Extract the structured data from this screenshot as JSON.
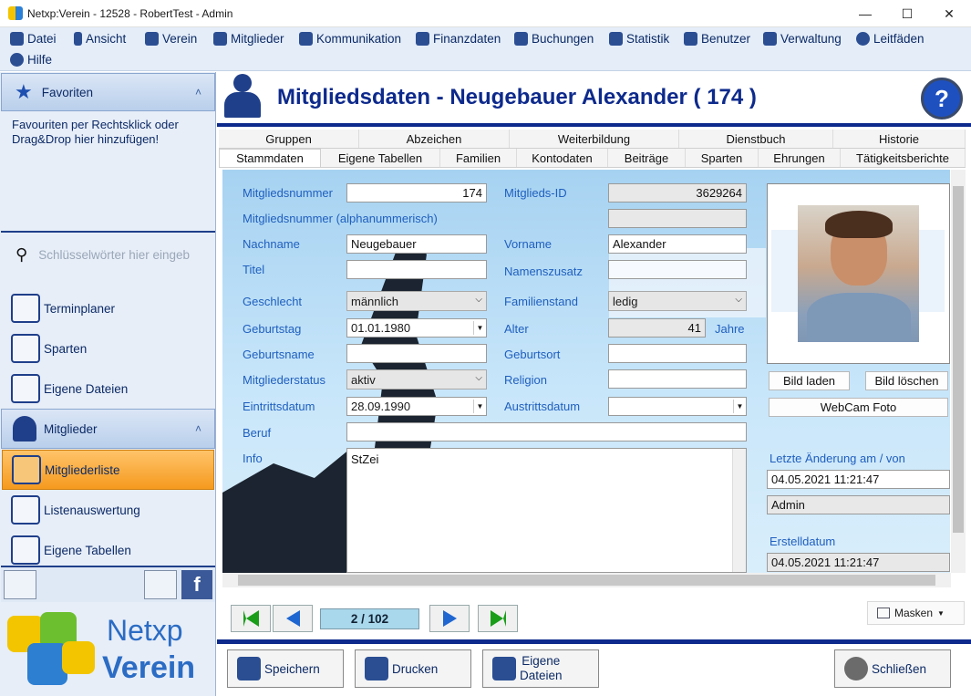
{
  "window": {
    "title": "Netxp:Verein - 12528 - RobertTest - Admin",
    "minimize": "—",
    "maximize": "☐",
    "close": "✕"
  },
  "menu": [
    {
      "label": "Datei",
      "icon": "folder-icon"
    },
    {
      "label": "Ansicht",
      "icon": "phone-icon"
    },
    {
      "label": "Verein",
      "icon": "home-icon"
    },
    {
      "label": "Mitglieder",
      "icon": "members-icon"
    },
    {
      "label": "Kommunikation",
      "icon": "mail-icon"
    },
    {
      "label": "Finanzdaten",
      "icon": "money-bag-icon"
    },
    {
      "label": "Buchungen",
      "icon": "bookings-icon"
    },
    {
      "label": "Statistik",
      "icon": "statistics-icon"
    },
    {
      "label": "Benutzer",
      "icon": "users-icon"
    },
    {
      "label": "Verwaltung",
      "icon": "tools-icon"
    },
    {
      "label": "Leitfäden",
      "icon": "info-icon"
    },
    {
      "label": "Hilfe",
      "icon": "help-icon"
    }
  ],
  "sidebar": {
    "favorites_title": "Favoriten",
    "favorites_hint": "Favouriten per Rechtsklick oder Drag&Drop hier hinzufügen!",
    "search_placeholder": "Schlüsselwörter hier eingeb",
    "items": [
      "Terminplaner",
      "Sparten",
      "Eigene Dateien"
    ],
    "members_title": "Mitglieder",
    "member_items": [
      "Mitgliederliste",
      "Listenauswertung",
      "Eigene Tabellen"
    ],
    "collapse": "˄",
    "logo_line1": "Netxp",
    "logo_line2": "Verein"
  },
  "header": {
    "title": "Mitgliedsdaten - Neugebauer Alexander ( 174 )",
    "help": "?"
  },
  "tabs_top": [
    "Gruppen",
    "Abzeichen",
    "Weiterbildung",
    "Dienstbuch",
    "Historie"
  ],
  "tabs_bottom": [
    "Stammdaten",
    "Eigene Tabellen",
    "Familien",
    "Kontodaten",
    "Beiträge",
    "Sparten",
    "Ehrungen",
    "Tätigkeitsberichte"
  ],
  "form": {
    "labels": {
      "mitgliedsnummer": "Mitgliedsnummer",
      "mitglieds_id": "Mitglieds-ID",
      "alphanum": "Mitgliedsnummer (alphanummerisch)",
      "nachname": "Nachname",
      "vorname": "Vorname",
      "titel": "Titel",
      "namenszusatz": "Namenszusatz",
      "geschlecht": "Geschlecht",
      "familienstand": "Familienstand",
      "geburtstag": "Geburtstag",
      "alter": "Alter",
      "jahre": "Jahre",
      "geburtsname": "Geburtsname",
      "geburtsort": "Geburtsort",
      "mitgliederstatus": "Mitgliederstatus",
      "religion": "Religion",
      "eintrittsdatum": "Eintrittsdatum",
      "austrittsdatum": "Austrittsdatum",
      "beruf": "Beruf",
      "info": "Info",
      "letzte_aenderung": "Letzte Änderung am / von",
      "erstelldatum": "Erstelldatum"
    },
    "values": {
      "mitgliedsnummer": "174",
      "mitglieds_id": "3629264",
      "alphanum": "",
      "nachname": "Neugebauer",
      "vorname": "Alexander",
      "titel": "",
      "namenszusatz": "",
      "geschlecht": "männlich",
      "familienstand": "ledig",
      "geburtstag": "01.01.1980",
      "alter": "41",
      "geburtsname": "",
      "geburtsort": "",
      "mitgliederstatus": "aktiv",
      "religion": "",
      "eintrittsdatum": "28.09.1990",
      "austrittsdatum": "",
      "beruf": "",
      "info": "StZei",
      "letzte_aenderung_datum": "04.05.2021 11:21:47",
      "letzte_aenderung_von": "Admin",
      "erstelldatum": "04.05.2021 11:21:47"
    },
    "buttons": {
      "bild_laden": "Bild laden",
      "bild_loeschen": "Bild löschen",
      "webcam": "WebCam Foto"
    }
  },
  "nav": {
    "record": "2 / 102",
    "masken": "Masken"
  },
  "actions": {
    "speichern": "Speichern",
    "drucken": "Drucken",
    "eigene_dateien_1": "Eigene",
    "eigene_dateien_2": "Dateien",
    "schliessen": "Schließen"
  }
}
